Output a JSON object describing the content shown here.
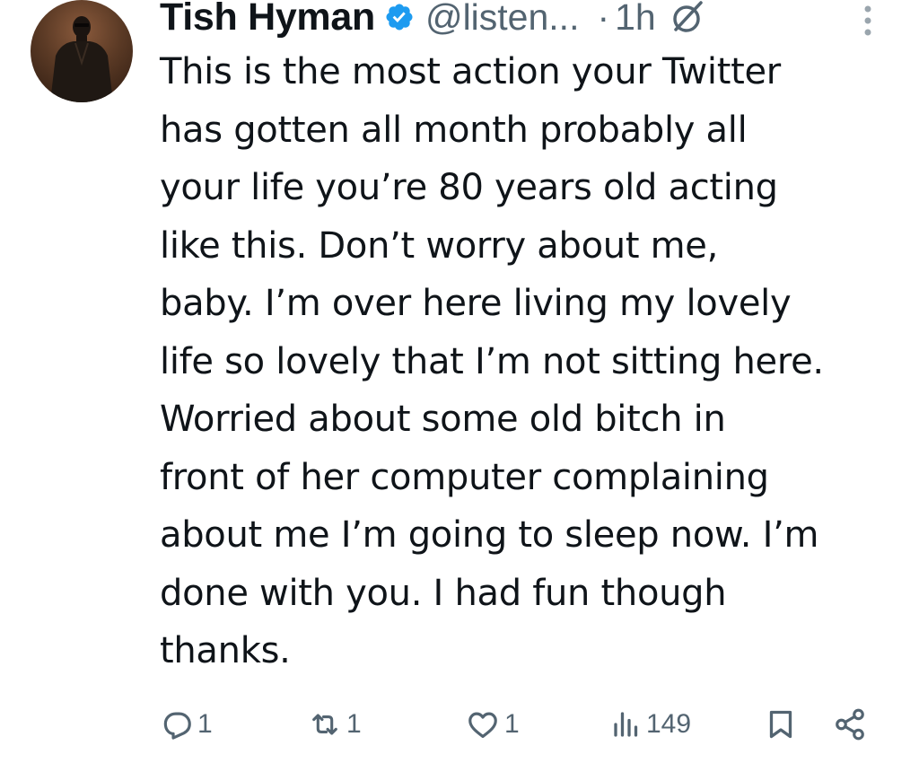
{
  "tweet": {
    "author_name": "Tish Hyman",
    "handle": "@listen...",
    "separator": "·",
    "time": "1h",
    "text": "This is the most action your Twitter\nhas gotten all month probably all\nyour life you’re 80 years old acting\nlike this. Don’t worry about me,\nbaby. I’m over here living my lovely\nlife so lovely that I’m not sitting here.\nWorried about some old bitch in\nfront of her computer complaining\nabout me I’m going to sleep now. I’m\ndone with you. I had fun though\nthanks."
  },
  "actions": {
    "replies": "1",
    "reposts": "1",
    "likes": "1",
    "views": "149"
  },
  "icons": {
    "avatar": "avatar-photo",
    "verified": "verified-badge-icon",
    "grok": "grok-icon",
    "more": "more-options-icon",
    "reply": "reply-icon",
    "repost": "repost-icon",
    "like": "like-icon",
    "views": "views-icon",
    "bookmark": "bookmark-icon",
    "share": "share-icon"
  },
  "colors": {
    "text": "#0f1419",
    "secondary": "#536471",
    "verified": "#1d9bf0"
  }
}
